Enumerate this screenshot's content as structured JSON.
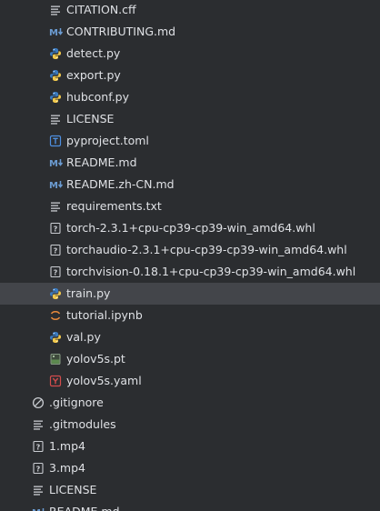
{
  "colors": {
    "background": "#2b2d30",
    "selected_row": "#43454a",
    "text": "#dfe1e5",
    "markdown_icon": "#6b9bd1",
    "python_blue": "#3b7bbf",
    "python_yellow": "#f2c94c",
    "toml_icon": "#4e8fe0",
    "yaml_icon": "#d24c4c",
    "notebook_icon": "#e88a3c"
  },
  "files": [
    {
      "name": "CITATION.cff",
      "icon": "text-lines-icon"
    },
    {
      "name": "CONTRIBUTING.md",
      "icon": "markdown-icon"
    },
    {
      "name": "detect.py",
      "icon": "python-icon"
    },
    {
      "name": "export.py",
      "icon": "python-icon"
    },
    {
      "name": "hubconf.py",
      "icon": "python-icon"
    },
    {
      "name": "LICENSE",
      "icon": "text-lines-icon"
    },
    {
      "name": "pyproject.toml",
      "icon": "toml-icon"
    },
    {
      "name": "README.md",
      "icon": "markdown-icon"
    },
    {
      "name": "README.zh-CN.md",
      "icon": "markdown-icon"
    },
    {
      "name": "requirements.txt",
      "icon": "text-lines-icon"
    },
    {
      "name": "torch-2.3.1+cpu-cp39-cp39-win_amd64.whl",
      "icon": "unknown-file-icon"
    },
    {
      "name": "torchaudio-2.3.1+cpu-cp39-cp39-win_amd64.whl",
      "icon": "unknown-file-icon"
    },
    {
      "name": "torchvision-0.18.1+cpu-cp39-cp39-win_amd64.whl",
      "icon": "unknown-file-icon"
    },
    {
      "name": "train.py",
      "icon": "python-icon",
      "selected": true
    },
    {
      "name": "tutorial.ipynb",
      "icon": "notebook-icon"
    },
    {
      "name": "val.py",
      "icon": "python-icon"
    },
    {
      "name": "yolov5s.pt",
      "icon": "binary-file-icon"
    },
    {
      "name": "yolov5s.yaml",
      "icon": "yaml-icon"
    },
    {
      "name": ".gitignore",
      "icon": "ignore-icon",
      "level": 1
    },
    {
      "name": ".gitmodules",
      "icon": "text-lines-icon",
      "level": 1
    },
    {
      "name": "1.mp4",
      "icon": "unknown-file-icon",
      "level": 1
    },
    {
      "name": "3.mp4",
      "icon": "unknown-file-icon",
      "level": 1
    },
    {
      "name": "LICENSE",
      "icon": "text-lines-icon",
      "level": 1
    },
    {
      "name": "README.md",
      "icon": "markdown-icon",
      "level": 1
    }
  ]
}
